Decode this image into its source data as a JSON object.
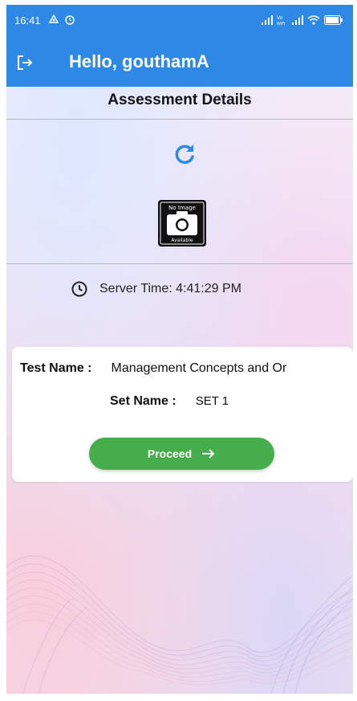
{
  "status_bar": {
    "time": "16:41",
    "notification_icons": [
      "app-notification-icon",
      "alarm-icon"
    ],
    "system_icons": [
      "signal-icon",
      "volte-icon",
      "signal-icon",
      "wifi-icon",
      "battery-icon"
    ],
    "volte_text": "Vo\nWiFi"
  },
  "app_bar": {
    "greeting": "Hello, gouthamA",
    "logout_icon": "logout-icon",
    "background_color": "#2e88e6"
  },
  "page": {
    "title": "Assessment Details",
    "refresh_icon": "refresh-icon",
    "no_image_top": "No Image",
    "no_image_bottom": "Available",
    "server_time": "Server Time: 4:41:29 PM",
    "clock_icon": "clock-icon"
  },
  "card": {
    "test_label": "Test Name :",
    "test_value": "Management Concepts and Or",
    "set_label": "Set Name :",
    "set_value": "SET 1",
    "proceed_label": "Proceed",
    "proceed_icon": "arrow-right-icon",
    "proceed_color": "#46ad4b"
  }
}
